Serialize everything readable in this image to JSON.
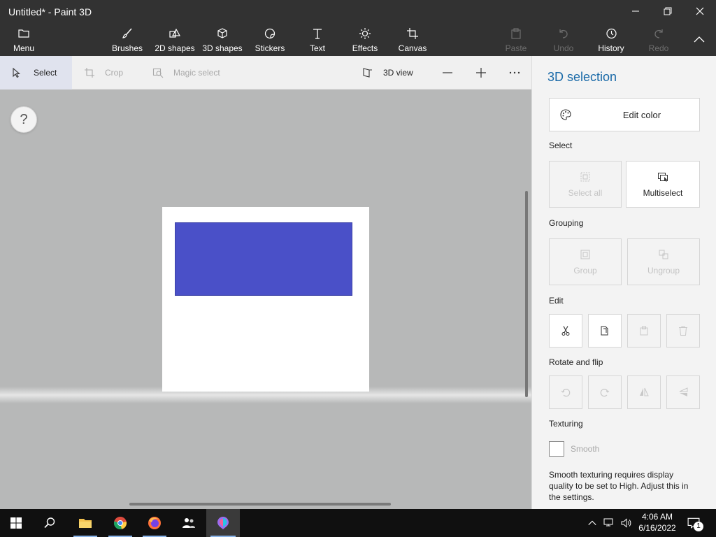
{
  "window": {
    "title": "Untitled* - Paint 3D"
  },
  "ribbon": {
    "menu": "Menu",
    "brushes": "Brushes",
    "shapes2d": "2D shapes",
    "shapes3d": "3D shapes",
    "stickers": "Stickers",
    "text": "Text",
    "effects": "Effects",
    "canvas": "Canvas",
    "paste": "Paste",
    "undo": "Undo",
    "history": "History",
    "redo": "Redo"
  },
  "toolbar": {
    "select": "Select",
    "crop": "Crop",
    "magic_select": "Magic select",
    "view3d": "3D view"
  },
  "workspace": {
    "help": "?"
  },
  "panel": {
    "title": "3D selection",
    "edit_color": "Edit color",
    "select_section": "Select",
    "select_all": "Select all",
    "multiselect": "Multiselect",
    "grouping_section": "Grouping",
    "group": "Group",
    "ungroup": "Ungroup",
    "edit_section": "Edit",
    "rotate_section": "Rotate and flip",
    "texturing_section": "Texturing",
    "smooth": "Smooth",
    "note": "Smooth texturing requires display quality to be set to High. Adjust this in the settings."
  },
  "taskbar": {
    "time": "4:06 AM",
    "date": "6/16/2022",
    "notification_count": "1"
  },
  "colors": {
    "shape": "#4a50c8",
    "accent": "#1a6aa8"
  }
}
